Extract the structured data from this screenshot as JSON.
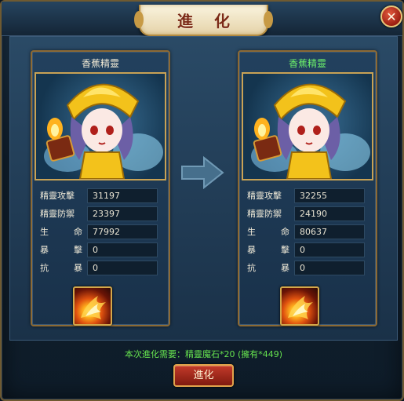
{
  "window": {
    "title": "進 化",
    "close_icon": "close-icon"
  },
  "cards": [
    {
      "name": "香蕉精靈",
      "stats": [
        {
          "label": "精靈攻擊",
          "value": "31197"
        },
        {
          "label": "精靈防禦",
          "value": "23397"
        },
        {
          "label": "生 命",
          "value": "77992"
        },
        {
          "label": "暴 擊",
          "value": "0"
        },
        {
          "label": "抗 暴",
          "value": "0"
        }
      ],
      "skill_icon": "fire-burst-icon"
    },
    {
      "name": "香蕉精靈",
      "stats": [
        {
          "label": "精靈攻擊",
          "value": "32255"
        },
        {
          "label": "精靈防禦",
          "value": "24190"
        },
        {
          "label": "生 命",
          "value": "80637"
        },
        {
          "label": "暴 擊",
          "value": "0"
        },
        {
          "label": "抗 暴",
          "value": "0"
        }
      ],
      "skill_icon": "fire-burst-icon"
    }
  ],
  "arrow_icon": "right-arrow-icon",
  "requirement": "本次進化需要：精靈魔石*20 (擁有*449)",
  "evolve_button": "進化",
  "colors": {
    "frame_gold": "#8d6a34",
    "panel_blue": "#22415e",
    "evolved_name_green": "#6df06a",
    "requirement_green": "#66e34f",
    "button_red": "#c33a2a"
  }
}
